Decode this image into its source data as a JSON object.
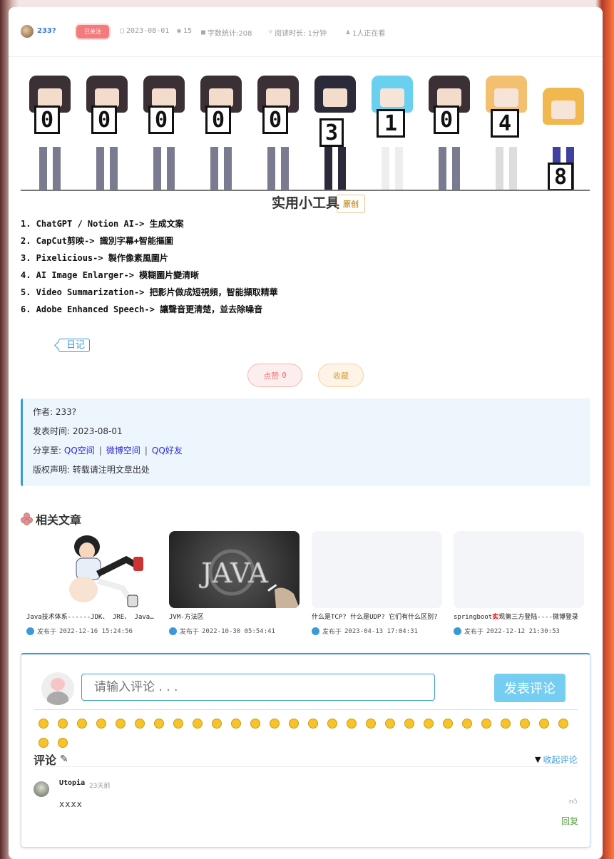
{
  "header": {
    "author": "233?",
    "follow_label": "已关注",
    "date": "2023-08-01",
    "views": "15",
    "word_count": "字数统计:208",
    "read_time": "阅读时长: 1分钟",
    "reading_now": "1人正在看"
  },
  "counter": {
    "digits": [
      "0",
      "0",
      "0",
      "0",
      "0",
      "3",
      "1",
      "0",
      "4",
      "8"
    ]
  },
  "article": {
    "title": "实用小工具",
    "badge": "原创",
    "items": [
      "1. ChatGPT / Notion AI-> 生成文案",
      "2. CapCut剪映-> 識別字幕+智能摳圖",
      "3. Pixelicious-> 製作像素風圖片",
      "4. AI Image Enlarger-> 模糊圖片變清晰",
      "5. Video Summarization-> 把影片做成短視頻，智能擷取精華",
      "6. Adobe Enhanced Speech-> 讓聲音更清楚，並去除噪音"
    ],
    "tag": "日记",
    "like_label": "点赞",
    "like_count": "0",
    "favorite_label": "收藏"
  },
  "info": {
    "author_line": "作者: 233?",
    "date_line": "发表时间: 2023-08-01",
    "share_prefix": "分享至:",
    "share_qq": "QQ空间",
    "share_weibo": "微博空间",
    "share_friend": "QQ好友",
    "copyright": "版权声明: 转载请注明文章出处"
  },
  "related": {
    "heading": "相关文章",
    "date_prefix": "发布于",
    "cards": [
      {
        "title": "Java技术体系------JDK、 JRE、 JavaSE",
        "date": "2022-12-16 15:24:56"
      },
      {
        "title": "JVM-方法区",
        "date": "2022-10-30 05:54:41",
        "thumb_text": "JAVA"
      },
      {
        "title": "什么是TCP? 什么是UDP? 它们有什么区别?",
        "date": "2023-04-13 17:04:31"
      },
      {
        "title_pre": "springboot",
        "title_hl": "实",
        "title_post": "现第三方登陆----微博登录",
        "date": "2022-12-12 21:30:53"
      }
    ]
  },
  "comments": {
    "input_placeholder": "请输入评论 . . .",
    "submit_label": "发表评论",
    "heading": "评论",
    "collapse_label": "收起评论",
    "list": [
      {
        "user": "Utopia",
        "time": "23天前",
        "text": "xxxx",
        "reply": "回复"
      }
    ]
  },
  "colors": {
    "accent": "#3a9ad9",
    "follow": "#f37b7b",
    "submit": "#76cdf2",
    "reply": "#5aa04a"
  }
}
